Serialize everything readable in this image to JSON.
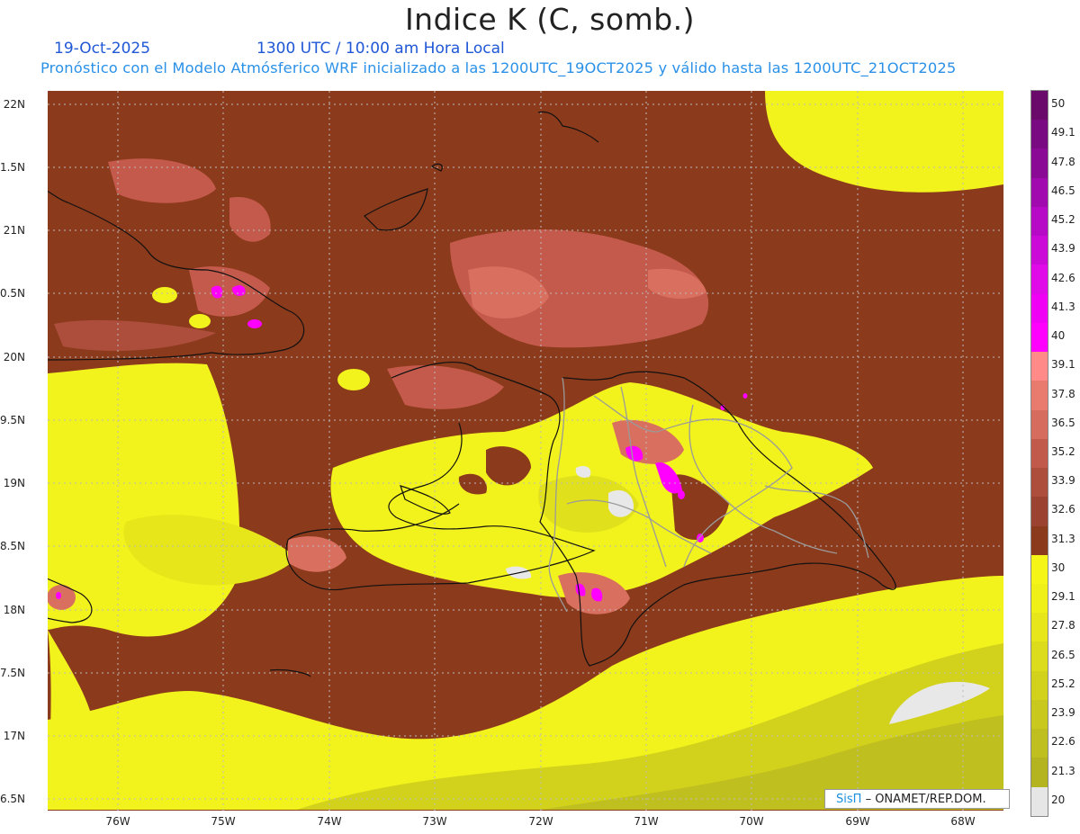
{
  "header": {
    "title": "Indice K (C, somb.)",
    "date": "19-Oct-2025",
    "time": "1300 UTC / 10:00 am Hora Local",
    "subtitle": "Pronóstico con el Modelo Atmósferico WRF inicializado a las 1200UTC_19OCT2025 y válido hasta las  1200UTC_21OCT2025"
  },
  "map": {
    "longitude_labels": [
      "76W",
      "75W",
      "74W",
      "73W",
      "72W",
      "71W",
      "70W",
      "69W",
      "68W"
    ],
    "latitude_labels": [
      "22N",
      "1.5N",
      "21N",
      "0.5N",
      "20N",
      "9.5N",
      "19N",
      "8.5N",
      "18N",
      "7.5N",
      "17N",
      "6.5N"
    ],
    "colors": {
      "background_field": "#8b3a1c",
      "yellow_band": "#f2f21c",
      "olive_band": "#bcbd20",
      "pink_band": "#d96f5f",
      "magenta_peak": "#ff00ff",
      "coast": "#111111",
      "borders": "#9a9a9a"
    }
  },
  "legend": {
    "labels": [
      "50",
      "49.1",
      "47.8",
      "46.5",
      "45.2",
      "43.9",
      "42.6",
      "41.3",
      "40",
      "39.1",
      "37.8",
      "36.5",
      "35.2",
      "33.9",
      "32.6",
      "31.3",
      "30",
      "29.1",
      "27.8",
      "26.5",
      "25.2",
      "23.9",
      "22.6",
      "21.3",
      "20"
    ],
    "colors": [
      "#6a0a6a",
      "#7a0a82",
      "#8a0a96",
      "#a00aae",
      "#b60ac6",
      "#cc0ad8",
      "#e00ae8",
      "#f000f4",
      "#ff00ff",
      "#ff8a88",
      "#e97a6e",
      "#d66c5e",
      "#c15a4b",
      "#ad4d3c",
      "#9b4230",
      "#8b3a1c",
      "#f5f518",
      "#f0f019",
      "#e6e61b",
      "#dcdc1c",
      "#d2d21d",
      "#c8c81e",
      "#bfbf1f",
      "#b4b420",
      "#e6e6e6"
    ]
  },
  "credit": {
    "logo": "SisΠ",
    "text": "– ONAMET/REP.DOM."
  }
}
